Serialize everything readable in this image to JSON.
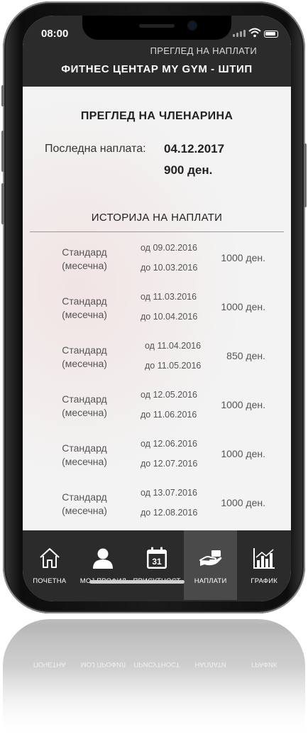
{
  "status_bar": {
    "time": "08:00",
    "icons": [
      "signal-icon",
      "wifi-icon",
      "battery-icon"
    ]
  },
  "header": {
    "subtitle": "ПРЕГЛЕД НА НАПЛАТИ",
    "title": "ФИТНЕС ЦЕНТАР MY GYM - ШТИП"
  },
  "membership": {
    "title": "ПРЕГЛЕД НА ЧЛЕНАРИНА",
    "last_payment_label": "Последна наплата:",
    "last_payment_date": "04.12.2017",
    "last_payment_amount": "900 ден."
  },
  "history": {
    "title": "ИСТОРИЈА НА НАПЛАТИ",
    "rows": [
      {
        "plan": "Стандард",
        "period": "(месечна)",
        "from": "од 09.02.2016",
        "to": "до 10.03.2016",
        "amount": "1000 ден."
      },
      {
        "plan": "Стандард",
        "period": "(месечна)",
        "from": "од 11.03.2016",
        "to": "до 10.04.2016",
        "amount": "1000 ден."
      },
      {
        "plan": "Стандард",
        "period": "(месечна)",
        "from": "од 11.04.2016",
        "to": "до 11.05.2016",
        "amount": "850 ден."
      },
      {
        "plan": "Стандард",
        "period": "(месечна)",
        "from": "од 12.05.2016",
        "to": "до 11.06.2016",
        "amount": "1000 ден."
      },
      {
        "plan": "Стандард",
        "period": "(месечна)",
        "from": "од 12.06.2016",
        "to": "до 12.07.2016",
        "amount": "1000 ден."
      },
      {
        "plan": "Стандард",
        "period": "(месечна)",
        "from": "од 13.07.2016",
        "to": "до 12.08.2016",
        "amount": "1000 ден."
      }
    ]
  },
  "nav": {
    "items": [
      {
        "label": "ПОЧЕТНА",
        "icon": "home-icon"
      },
      {
        "label": "МОЈ ПРОФИЛ",
        "icon": "user-icon"
      },
      {
        "label": "ПРИСУТНОСТ",
        "icon": "calendar-icon",
        "calendar_day": "31"
      },
      {
        "label": "НАПЛАТИ",
        "icon": "payment-hand-icon",
        "active": true
      },
      {
        "label": "ГРАФИК",
        "icon": "chart-icon"
      }
    ]
  },
  "colors": {
    "bar": "#2b2b2b",
    "active_tab": "#4a4a4a",
    "content_bg": "#f3f3f3"
  }
}
